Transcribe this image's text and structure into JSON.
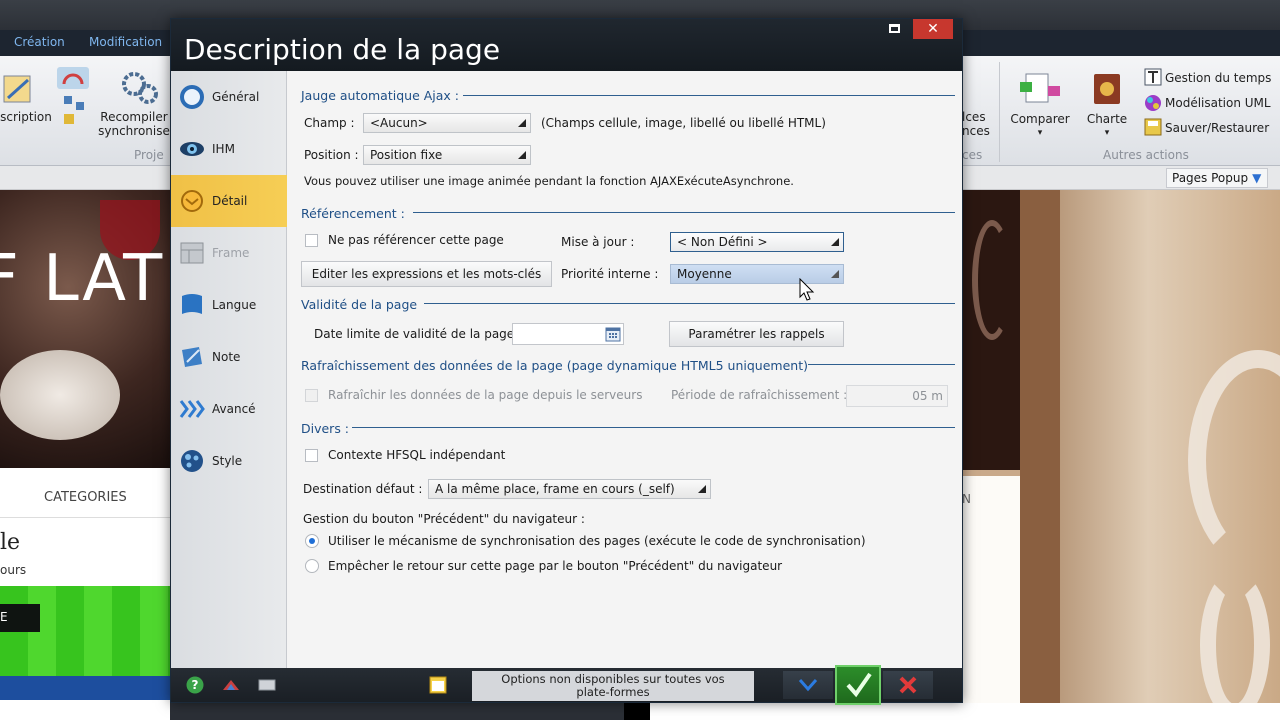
{
  "app": {
    "menu": [
      "Création",
      "Modification"
    ],
    "ribbon": {
      "description_label": "scription",
      "recompile_label_1": "Recompiler",
      "recompile_label_2": "synchronise",
      "group_projet": "Proje",
      "nces_label_1": "nces",
      "nces_label_2": "lces",
      "compare_label": "Comparer",
      "charte_label": "Charte",
      "gestion_temps": "Gestion du temps",
      "modelisation_uml": "Modélisation UML",
      "sauver_restaurer": "Sauver/Restaurer",
      "group_autres": "Autres actions",
      "group_ces": "ces"
    },
    "pages_popup": "Pages Popup",
    "canvas": {
      "hero_text": "F LAT",
      "categories": "CATEGORIES",
      "le_text": "le",
      "ours_text": "ours",
      "green_btn": "E",
      "right_nav_text": "N"
    }
  },
  "dialog": {
    "title": "Description de la page",
    "nav": [
      {
        "label": "Général",
        "icon": "circle-icon"
      },
      {
        "label": "IHM",
        "icon": "eye-icon"
      },
      {
        "label": "Détail",
        "icon": "detail-icon"
      },
      {
        "label": "Frame",
        "icon": "frame-icon"
      },
      {
        "label": "Langue",
        "icon": "flag-icon"
      },
      {
        "label": "Note",
        "icon": "note-icon"
      },
      {
        "label": "Avancé",
        "icon": "chevrons-icon"
      },
      {
        "label": "Style",
        "icon": "palette-icon"
      }
    ],
    "jauge": {
      "section": "Jauge automatique Ajax :",
      "champ_label": "Champ :",
      "champ_value": "<Aucun>",
      "champ_hint": "(Champs cellule, image, libellé ou libellé HTML)",
      "position_label": "Position :",
      "position_value": "Position fixe",
      "info": "Vous pouvez utiliser une image animée pendant la fonction AJAXExécuteAsynchrone."
    },
    "referencement": {
      "section": "Référencement :",
      "no_ref_label": "Ne pas référencer cette page",
      "maj_label": "Mise à jour :",
      "maj_value": "< Non Défini >",
      "edit_button": "Editer les expressions et les mots-clés",
      "priorite_label": "Priorité interne :",
      "priorite_value": "Moyenne"
    },
    "validite": {
      "section": "Validité de la page",
      "date_label": "Date limite de validité de la page :",
      "date_value": "",
      "rappels_button": "Paramétrer les rappels"
    },
    "rafraichissement": {
      "section": "Rafraîchissement des données de la page (page dynamique HTML5 uniquement)",
      "refresh_label": "Rafraîchir les données de la page depuis le serveurs",
      "periode_label": "Période de rafraîchissement :",
      "periode_value": "05 m"
    },
    "divers": {
      "section": "Divers :",
      "hfsql_label": "Contexte HFSQL indépendant",
      "destination_label": "Destination défaut :",
      "destination_value": "A la même place, frame en cours (_self)",
      "precedent_label": "Gestion du bouton \"Précédent\" du navigateur :",
      "radio1": "Utiliser le mécanisme de synchronisation des pages (exécute le code de synchronisation)",
      "radio2": "Empêcher le retour sur cette page par le bouton \"Précédent\" du navigateur"
    },
    "footer": {
      "note_line1": "Options non disponibles sur toutes vos",
      "note_line2": "plate-formes"
    }
  },
  "colors": {
    "section_title": "#1f4f86",
    "active_nav": "#f6ce55",
    "ok_green": "#2c8d2a",
    "close_red": "#c7372e"
  }
}
